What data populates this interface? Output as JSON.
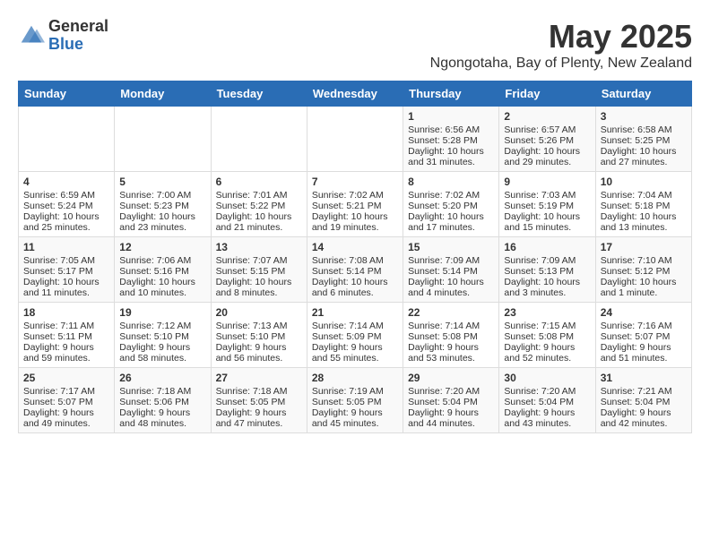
{
  "logo": {
    "general": "General",
    "blue": "Blue"
  },
  "title": "May 2025",
  "location": "Ngongotaha, Bay of Plenty, New Zealand",
  "headers": [
    "Sunday",
    "Monday",
    "Tuesday",
    "Wednesday",
    "Thursday",
    "Friday",
    "Saturday"
  ],
  "weeks": [
    [
      {
        "day": "",
        "lines": []
      },
      {
        "day": "",
        "lines": []
      },
      {
        "day": "",
        "lines": []
      },
      {
        "day": "",
        "lines": []
      },
      {
        "day": "1",
        "lines": [
          "Sunrise: 6:56 AM",
          "Sunset: 5:28 PM",
          "Daylight: 10 hours",
          "and 31 minutes."
        ]
      },
      {
        "day": "2",
        "lines": [
          "Sunrise: 6:57 AM",
          "Sunset: 5:26 PM",
          "Daylight: 10 hours",
          "and 29 minutes."
        ]
      },
      {
        "day": "3",
        "lines": [
          "Sunrise: 6:58 AM",
          "Sunset: 5:25 PM",
          "Daylight: 10 hours",
          "and 27 minutes."
        ]
      }
    ],
    [
      {
        "day": "4",
        "lines": [
          "Sunrise: 6:59 AM",
          "Sunset: 5:24 PM",
          "Daylight: 10 hours",
          "and 25 minutes."
        ]
      },
      {
        "day": "5",
        "lines": [
          "Sunrise: 7:00 AM",
          "Sunset: 5:23 PM",
          "Daylight: 10 hours",
          "and 23 minutes."
        ]
      },
      {
        "day": "6",
        "lines": [
          "Sunrise: 7:01 AM",
          "Sunset: 5:22 PM",
          "Daylight: 10 hours",
          "and 21 minutes."
        ]
      },
      {
        "day": "7",
        "lines": [
          "Sunrise: 7:02 AM",
          "Sunset: 5:21 PM",
          "Daylight: 10 hours",
          "and 19 minutes."
        ]
      },
      {
        "day": "8",
        "lines": [
          "Sunrise: 7:02 AM",
          "Sunset: 5:20 PM",
          "Daylight: 10 hours",
          "and 17 minutes."
        ]
      },
      {
        "day": "9",
        "lines": [
          "Sunrise: 7:03 AM",
          "Sunset: 5:19 PM",
          "Daylight: 10 hours",
          "and 15 minutes."
        ]
      },
      {
        "day": "10",
        "lines": [
          "Sunrise: 7:04 AM",
          "Sunset: 5:18 PM",
          "Daylight: 10 hours",
          "and 13 minutes."
        ]
      }
    ],
    [
      {
        "day": "11",
        "lines": [
          "Sunrise: 7:05 AM",
          "Sunset: 5:17 PM",
          "Daylight: 10 hours",
          "and 11 minutes."
        ]
      },
      {
        "day": "12",
        "lines": [
          "Sunrise: 7:06 AM",
          "Sunset: 5:16 PM",
          "Daylight: 10 hours",
          "and 10 minutes."
        ]
      },
      {
        "day": "13",
        "lines": [
          "Sunrise: 7:07 AM",
          "Sunset: 5:15 PM",
          "Daylight: 10 hours",
          "and 8 minutes."
        ]
      },
      {
        "day": "14",
        "lines": [
          "Sunrise: 7:08 AM",
          "Sunset: 5:14 PM",
          "Daylight: 10 hours",
          "and 6 minutes."
        ]
      },
      {
        "day": "15",
        "lines": [
          "Sunrise: 7:09 AM",
          "Sunset: 5:14 PM",
          "Daylight: 10 hours",
          "and 4 minutes."
        ]
      },
      {
        "day": "16",
        "lines": [
          "Sunrise: 7:09 AM",
          "Sunset: 5:13 PM",
          "Daylight: 10 hours",
          "and 3 minutes."
        ]
      },
      {
        "day": "17",
        "lines": [
          "Sunrise: 7:10 AM",
          "Sunset: 5:12 PM",
          "Daylight: 10 hours",
          "and 1 minute."
        ]
      }
    ],
    [
      {
        "day": "18",
        "lines": [
          "Sunrise: 7:11 AM",
          "Sunset: 5:11 PM",
          "Daylight: 9 hours",
          "and 59 minutes."
        ]
      },
      {
        "day": "19",
        "lines": [
          "Sunrise: 7:12 AM",
          "Sunset: 5:10 PM",
          "Daylight: 9 hours",
          "and 58 minutes."
        ]
      },
      {
        "day": "20",
        "lines": [
          "Sunrise: 7:13 AM",
          "Sunset: 5:10 PM",
          "Daylight: 9 hours",
          "and 56 minutes."
        ]
      },
      {
        "day": "21",
        "lines": [
          "Sunrise: 7:14 AM",
          "Sunset: 5:09 PM",
          "Daylight: 9 hours",
          "and 55 minutes."
        ]
      },
      {
        "day": "22",
        "lines": [
          "Sunrise: 7:14 AM",
          "Sunset: 5:08 PM",
          "Daylight: 9 hours",
          "and 53 minutes."
        ]
      },
      {
        "day": "23",
        "lines": [
          "Sunrise: 7:15 AM",
          "Sunset: 5:08 PM",
          "Daylight: 9 hours",
          "and 52 minutes."
        ]
      },
      {
        "day": "24",
        "lines": [
          "Sunrise: 7:16 AM",
          "Sunset: 5:07 PM",
          "Daylight: 9 hours",
          "and 51 minutes."
        ]
      }
    ],
    [
      {
        "day": "25",
        "lines": [
          "Sunrise: 7:17 AM",
          "Sunset: 5:07 PM",
          "Daylight: 9 hours",
          "and 49 minutes."
        ]
      },
      {
        "day": "26",
        "lines": [
          "Sunrise: 7:18 AM",
          "Sunset: 5:06 PM",
          "Daylight: 9 hours",
          "and 48 minutes."
        ]
      },
      {
        "day": "27",
        "lines": [
          "Sunrise: 7:18 AM",
          "Sunset: 5:05 PM",
          "Daylight: 9 hours",
          "and 47 minutes."
        ]
      },
      {
        "day": "28",
        "lines": [
          "Sunrise: 7:19 AM",
          "Sunset: 5:05 PM",
          "Daylight: 9 hours",
          "and 45 minutes."
        ]
      },
      {
        "day": "29",
        "lines": [
          "Sunrise: 7:20 AM",
          "Sunset: 5:04 PM",
          "Daylight: 9 hours",
          "and 44 minutes."
        ]
      },
      {
        "day": "30",
        "lines": [
          "Sunrise: 7:20 AM",
          "Sunset: 5:04 PM",
          "Daylight: 9 hours",
          "and 43 minutes."
        ]
      },
      {
        "day": "31",
        "lines": [
          "Sunrise: 7:21 AM",
          "Sunset: 5:04 PM",
          "Daylight: 9 hours",
          "and 42 minutes."
        ]
      }
    ]
  ]
}
